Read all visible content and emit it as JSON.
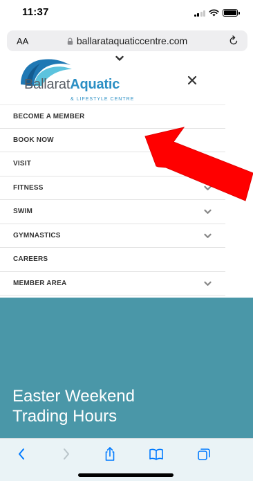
{
  "status_bar": {
    "time": "11:37"
  },
  "browser": {
    "text_size_label": "AA",
    "url": "ballarataquaticcentre.com"
  },
  "site": {
    "logo": {
      "name_regular": "Ballarat",
      "name_bold": "Aquatic",
      "tagline": "& LIFESTYLE CENTRE"
    }
  },
  "menu": {
    "items": [
      {
        "label": "BECOME A MEMBER",
        "has_submenu": false
      },
      {
        "label": "BOOK NOW",
        "has_submenu": false
      },
      {
        "label": "VISIT",
        "has_submenu": false
      },
      {
        "label": "FITNESS",
        "has_submenu": true
      },
      {
        "label": "SWIM",
        "has_submenu": true
      },
      {
        "label": "GYMNASTICS",
        "has_submenu": true
      },
      {
        "label": "CAREERS",
        "has_submenu": false
      },
      {
        "label": "MEMBER AREA",
        "has_submenu": true
      }
    ]
  },
  "hero": {
    "title_line1": "Easter Weekend",
    "title_line2": "Trading Hours"
  },
  "colors": {
    "brand_blue": "#2b8fc4",
    "hero_teal": "#4a97a8",
    "annotation_red": "#ff0000",
    "safari_blue": "#007aff"
  },
  "icons": {
    "toolbar": [
      "back-icon",
      "forward-icon",
      "share-icon",
      "bookmarks-icon",
      "tabs-icon"
    ]
  }
}
